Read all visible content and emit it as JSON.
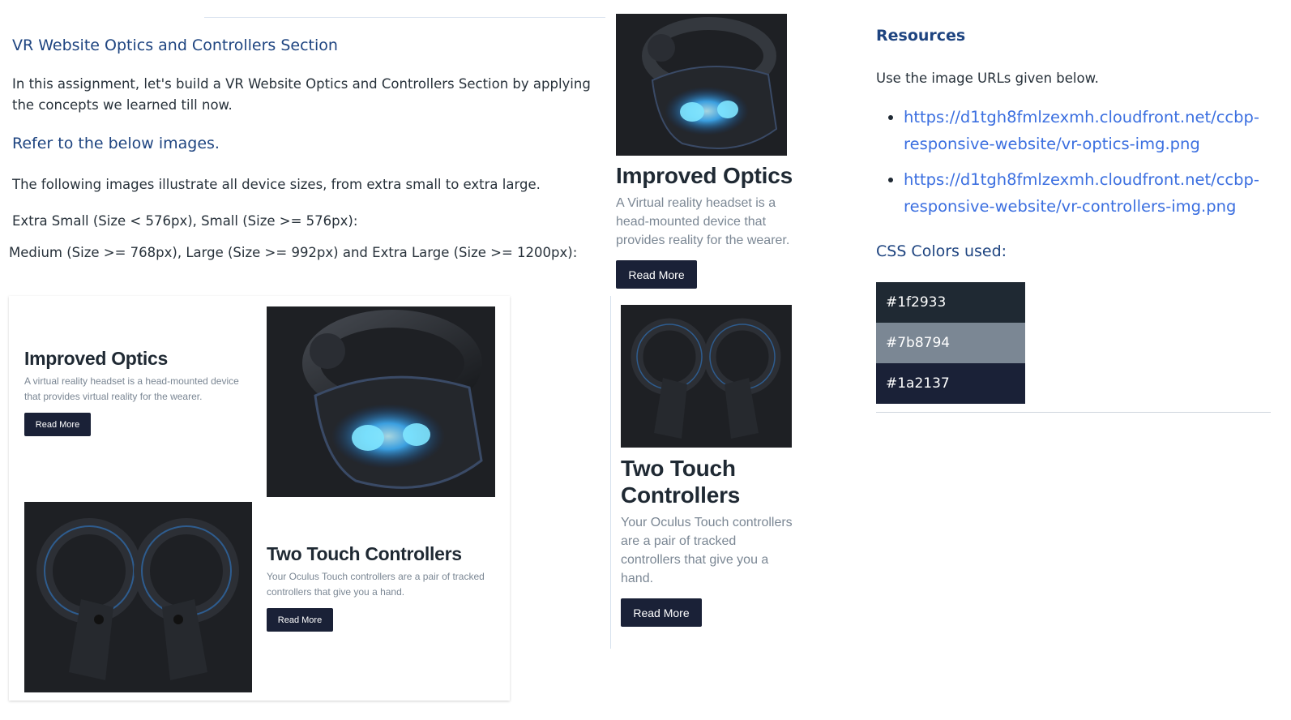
{
  "header": {
    "title": "VR Website Optics and Controllers Section",
    "intro": "In this assignment, let's build a VR Website Optics and Controllers Section by applying the concepts we learned till now.",
    "refer": "Refer to the below images.",
    "follow": "The following images illustrate all device sizes, from extra small to extra large.",
    "xs_sm": "Extra Small (Size < 576px), Small (Size >= 576px):",
    "md_lg_xl": "Medium (Size >= 768px), Large (Size >= 992px) and Extra Large (Size >= 1200px):"
  },
  "preview_large": {
    "optics": {
      "heading": "Improved Optics",
      "description": "A virtual reality headset is a head-mounted device that provides virtual reality for the wearer.",
      "button": "Read More"
    },
    "controllers": {
      "heading": "Two Touch Controllers",
      "description": "Your Oculus Touch controllers are a pair of tracked controllers that give you a hand.",
      "button": "Read More"
    }
  },
  "preview_small": {
    "optics": {
      "heading": "Improved Optics",
      "description": "A Virtual reality headset is a head-mounted device that provides reality for the wearer.",
      "button": "Read More"
    },
    "controllers": {
      "heading": "Two Touch Controllers",
      "description": "Your Oculus Touch controllers are a pair of tracked controllers that give you a hand.",
      "button": "Read More"
    }
  },
  "resources": {
    "title": "Resources",
    "use_text": "Use the image URLs given below.",
    "links": [
      "https://d1tgh8fmlzexmh.cloudfront.net/ccbp-responsive-website/vr-optics-img.png",
      "https://d1tgh8fmlzexmh.cloudfront.net/ccbp-responsive-website/vr-controllers-img.png"
    ],
    "colors_title": "CSS Colors used:",
    "colors": [
      "#1f2933",
      "#7b8794",
      "#1a2137"
    ]
  }
}
